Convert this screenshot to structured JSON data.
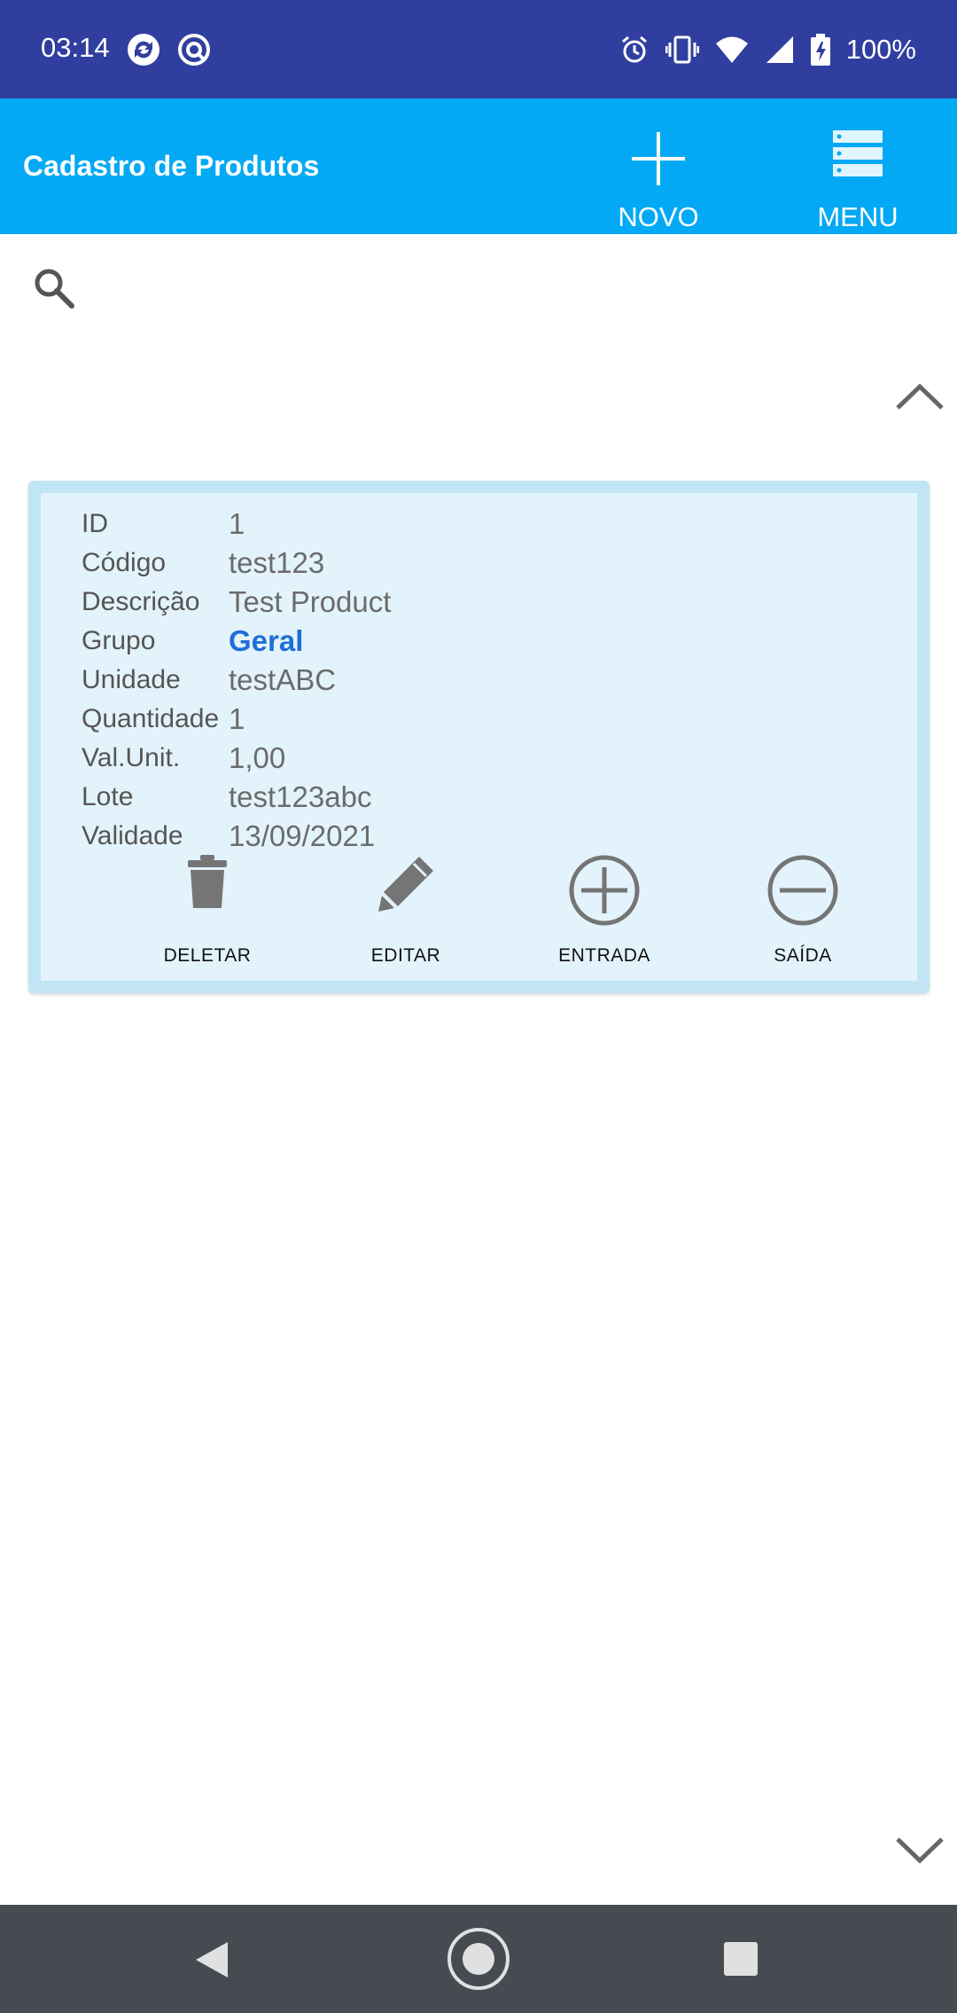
{
  "status_bar": {
    "time": "03:14",
    "battery": "100%",
    "icons": [
      "sync-app-icon",
      "vpn-app-icon",
      "alarm-icon",
      "vibrate-icon",
      "wifi-icon",
      "signal-icon",
      "battery-charging-icon"
    ]
  },
  "app_bar": {
    "title": "Cadastro de Produtos",
    "novo_label": "NOVO",
    "menu_label": "MENU",
    "background": "#03a9f4"
  },
  "product": {
    "rows": [
      {
        "label": "ID",
        "value": "1"
      },
      {
        "label": "Código",
        "value": "test123"
      },
      {
        "label": "Descrição",
        "value": "Test Product"
      },
      {
        "label": "Grupo",
        "value": "Geral"
      },
      {
        "label": "Unidade",
        "value": "testABC"
      },
      {
        "label": "Quantidade",
        "value": "1"
      },
      {
        "label": "Val.Unit.",
        "value": "1,00"
      },
      {
        "label": "Lote",
        "value": "test123abc"
      },
      {
        "label": "Validade",
        "value": "13/09/2021"
      }
    ],
    "actions": {
      "deletar": "DELETAR",
      "editar": "EDITAR",
      "entrada": "ENTRADA",
      "saida": "SAÍDA"
    },
    "group_color": "#1e6fd6"
  },
  "colors": {
    "status_bar": "#303f9f",
    "card_border": "#c1e5f4",
    "card_fill": "#e3f3fb",
    "nav_bar": "#454b51"
  }
}
